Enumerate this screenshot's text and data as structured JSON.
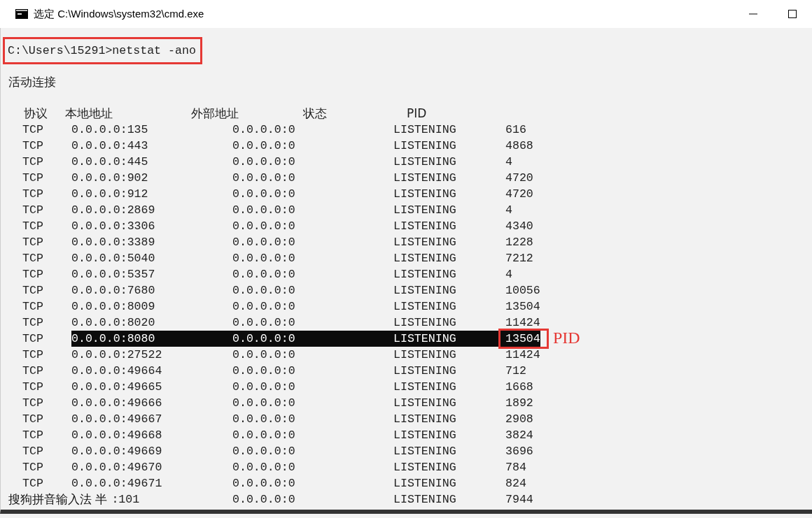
{
  "window": {
    "title": "选定 C:\\Windows\\system32\\cmd.exe"
  },
  "prompt": {
    "text": "C:\\Users\\15291>netstat -ano",
    "boxed": true
  },
  "section_title": "活动连接",
  "columns": [
    "协议",
    "本地地址",
    "外部地址",
    "状态",
    "PID"
  ],
  "rows": [
    {
      "proto": "TCP",
      "local": "0.0.0.0:135",
      "foreign": "0.0.0.0:0",
      "state": "LISTENING",
      "pid": "616",
      "selected": false
    },
    {
      "proto": "TCP",
      "local": "0.0.0.0:443",
      "foreign": "0.0.0.0:0",
      "state": "LISTENING",
      "pid": "4868",
      "selected": false
    },
    {
      "proto": "TCP",
      "local": "0.0.0.0:445",
      "foreign": "0.0.0.0:0",
      "state": "LISTENING",
      "pid": "4",
      "selected": false
    },
    {
      "proto": "TCP",
      "local": "0.0.0.0:902",
      "foreign": "0.0.0.0:0",
      "state": "LISTENING",
      "pid": "4720",
      "selected": false
    },
    {
      "proto": "TCP",
      "local": "0.0.0.0:912",
      "foreign": "0.0.0.0:0",
      "state": "LISTENING",
      "pid": "4720",
      "selected": false
    },
    {
      "proto": "TCP",
      "local": "0.0.0.0:2869",
      "foreign": "0.0.0.0:0",
      "state": "LISTENING",
      "pid": "4",
      "selected": false
    },
    {
      "proto": "TCP",
      "local": "0.0.0.0:3306",
      "foreign": "0.0.0.0:0",
      "state": "LISTENING",
      "pid": "4340",
      "selected": false
    },
    {
      "proto": "TCP",
      "local": "0.0.0.0:3389",
      "foreign": "0.0.0.0:0",
      "state": "LISTENING",
      "pid": "1228",
      "selected": false
    },
    {
      "proto": "TCP",
      "local": "0.0.0.0:5040",
      "foreign": "0.0.0.0:0",
      "state": "LISTENING",
      "pid": "7212",
      "selected": false
    },
    {
      "proto": "TCP",
      "local": "0.0.0.0:5357",
      "foreign": "0.0.0.0:0",
      "state": "LISTENING",
      "pid": "4",
      "selected": false
    },
    {
      "proto": "TCP",
      "local": "0.0.0.0:7680",
      "foreign": "0.0.0.0:0",
      "state": "LISTENING",
      "pid": "10056",
      "selected": false
    },
    {
      "proto": "TCP",
      "local": "0.0.0.0:8009",
      "foreign": "0.0.0.0:0",
      "state": "LISTENING",
      "pid": "13504",
      "selected": false
    },
    {
      "proto": "TCP",
      "local": "0.0.0.0:8020",
      "foreign": "0.0.0.0:0",
      "state": "LISTENING",
      "pid": "11424",
      "selected": false
    },
    {
      "proto": "TCP",
      "local": "0.0.0.0:8080",
      "foreign": "0.0.0.0:0",
      "state": "LISTENING",
      "pid": "13504",
      "selected": true,
      "callout": "PID"
    },
    {
      "proto": "TCP",
      "local": "0.0.0.0:27522",
      "foreign": "0.0.0.0:0",
      "state": "LISTENING",
      "pid": "11424",
      "selected": false
    },
    {
      "proto": "TCP",
      "local": "0.0.0.0:49664",
      "foreign": "0.0.0.0:0",
      "state": "LISTENING",
      "pid": "712",
      "selected": false
    },
    {
      "proto": "TCP",
      "local": "0.0.0.0:49665",
      "foreign": "0.0.0.0:0",
      "state": "LISTENING",
      "pid": "1668",
      "selected": false
    },
    {
      "proto": "TCP",
      "local": "0.0.0.0:49666",
      "foreign": "0.0.0.0:0",
      "state": "LISTENING",
      "pid": "1892",
      "selected": false
    },
    {
      "proto": "TCP",
      "local": "0.0.0.0:49667",
      "foreign": "0.0.0.0:0",
      "state": "LISTENING",
      "pid": "2908",
      "selected": false
    },
    {
      "proto": "TCP",
      "local": "0.0.0.0:49668",
      "foreign": "0.0.0.0:0",
      "state": "LISTENING",
      "pid": "3824",
      "selected": false
    },
    {
      "proto": "TCP",
      "local": "0.0.0.0:49669",
      "foreign": "0.0.0.0:0",
      "state": "LISTENING",
      "pid": "3696",
      "selected": false
    },
    {
      "proto": "TCP",
      "local": "0.0.0.0:49670",
      "foreign": "0.0.0.0:0",
      "state": "LISTENING",
      "pid": "784",
      "selected": false
    },
    {
      "proto": "TCP",
      "local": "0.0.0.0:49671",
      "foreign": "0.0.0.0:0",
      "state": "LISTENING",
      "pid": "824",
      "selected": false
    },
    {
      "ime": "搜狗拼音输入法 半",
      "local": ":101",
      "foreign": "0.0.0.0:0",
      "state": "LISTENING",
      "pid": "7944",
      "selected": false
    }
  ]
}
